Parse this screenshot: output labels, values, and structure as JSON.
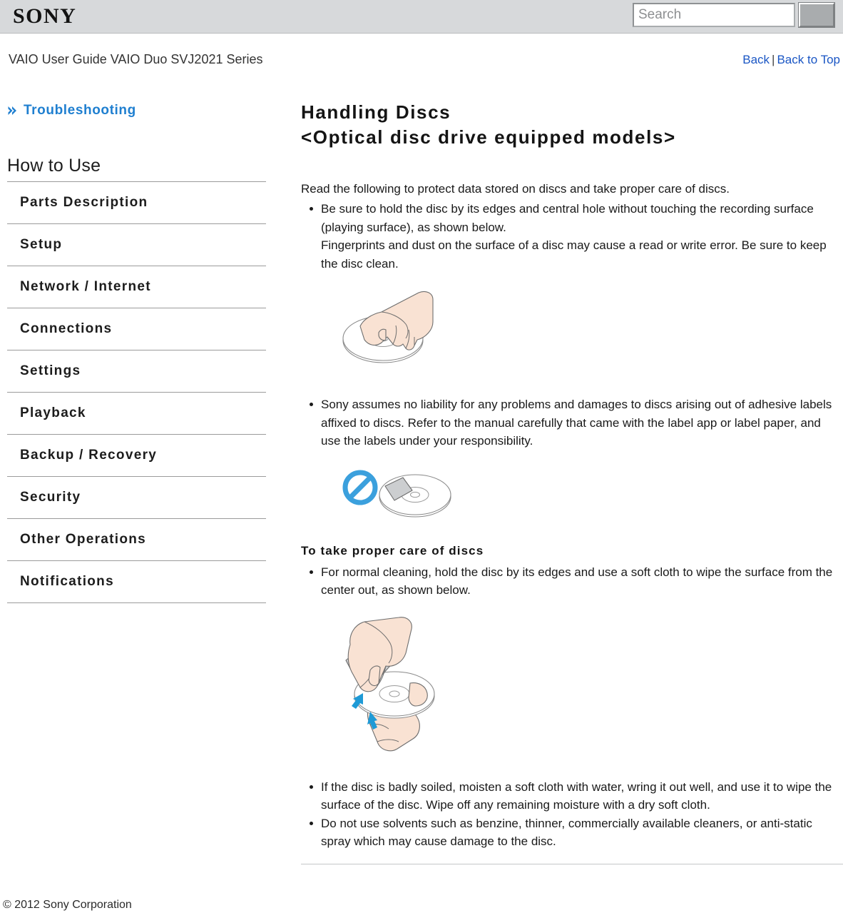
{
  "header": {
    "logo_text": "SONY",
    "search": {
      "placeholder": "Search",
      "value": "",
      "button_label": ""
    }
  },
  "subheader": {
    "guide_title": "VAIO User Guide VAIO Duo SVJ2021 Series",
    "back_link": "Back",
    "separator": "|",
    "back_to_top_link": "Back to Top"
  },
  "sidebar": {
    "breadcrumb": "Troubleshooting",
    "section_title": "How to Use",
    "items": [
      {
        "label": "Parts Description"
      },
      {
        "label": "Setup"
      },
      {
        "label": "Network / Internet"
      },
      {
        "label": "Connections"
      },
      {
        "label": "Settings"
      },
      {
        "label": "Playback"
      },
      {
        "label": "Backup / Recovery"
      },
      {
        "label": "Security"
      },
      {
        "label": "Other Operations"
      },
      {
        "label": "Notifications"
      }
    ]
  },
  "main": {
    "title_line1": "Handling Discs",
    "title_line2": "<Optical disc drive equipped models>",
    "intro": "Read the following to protect data stored on discs and take proper care of discs.",
    "bullet_1": "Be sure to hold the disc by its edges and central hole without touching the recording surface (playing surface), as shown below.",
    "bullet_1_line2": "Fingerprints and dust on the surface of a disc may cause a read or write error. Be sure to keep the disc clean.",
    "figure_1_name": "hand-holding-disc-illustration",
    "bullet_2": "Sony assumes no liability for any problems and damages to discs arising out of adhesive labels affixed to discs. Refer to the manual carefully that came with the label app or label paper, and use the labels under your responsibility.",
    "figure_2_name": "no-adhesive-label-on-disc-illustration",
    "sub_heading": "To take proper care of discs",
    "bullet_3": "For normal cleaning, hold the disc by its edges and use a soft cloth to wipe the surface from the center out, as shown below.",
    "figure_3_name": "wiping-disc-with-cloth-illustration",
    "bullet_4": "If the disc is badly soiled, moisten a soft cloth with water, wring it out well, and use it to wipe the surface of the disc. Wipe off any remaining moisture with a dry soft cloth.",
    "bullet_5": "Do not use solvents such as benzine, thinner, commercially available cleaners, or anti-static spray which may cause damage to the disc."
  },
  "footer": {
    "copyright": "© 2012 Sony Corporation"
  },
  "colors": {
    "header_bg": "#d7d9db",
    "link_blue": "#1a56c4",
    "breadcrumb_blue": "#1f7fd0",
    "rule_gray": "#9b9b9b",
    "prohibition_blue": "#3ba0dd",
    "skin_tone": "#f7ded0",
    "cloth_gray": "#c9cbcd",
    "arrow_blue": "#1e9ad6"
  }
}
